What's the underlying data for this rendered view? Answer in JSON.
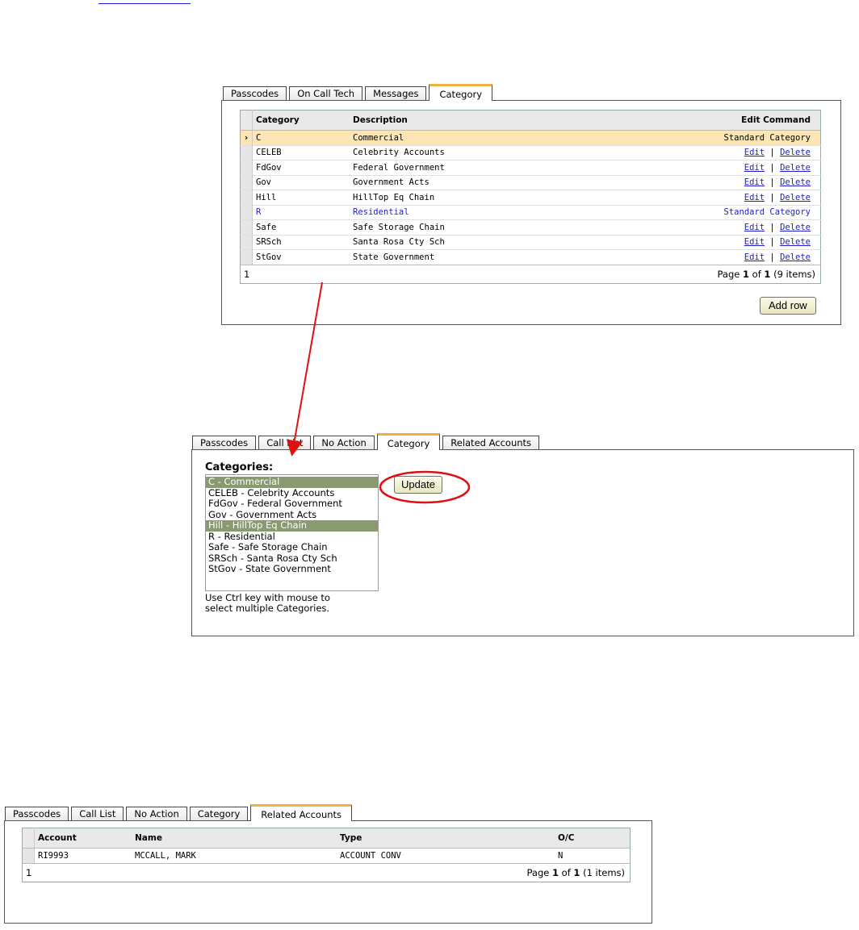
{
  "top_panel": {
    "tabs": [
      "Passcodes",
      "On Call Tech",
      "Messages",
      "Category"
    ],
    "active_tab": 3,
    "columns": {
      "category": "Category",
      "description": "Description",
      "edit_command": "Edit Command"
    },
    "rows": [
      {
        "category": "C",
        "description": "Commercial",
        "command": "Standard Category",
        "standard": true,
        "active": true
      },
      {
        "category": "CELEB",
        "description": "Celebrity Accounts",
        "standard": false
      },
      {
        "category": "FdGov",
        "description": "Federal Government",
        "standard": false
      },
      {
        "category": "Gov",
        "description": "Government Acts",
        "standard": false
      },
      {
        "category": "Hill",
        "description": "HillTop Eq Chain",
        "standard": false
      },
      {
        "category": "R",
        "description": "Residential",
        "command": "Standard Category",
        "standard": true,
        "blue": true
      },
      {
        "category": "Safe",
        "description": "Safe Storage Chain",
        "standard": false
      },
      {
        "category": "SRSch",
        "description": "Santa Rosa Cty Sch",
        "standard": false
      },
      {
        "category": "StGov",
        "description": "State Government",
        "standard": false
      }
    ],
    "edit_label": "Edit",
    "separator": "|",
    "delete_label": "Delete",
    "pager": {
      "page_number": "1",
      "page_word": "Page",
      "current": "1",
      "of_word": "of",
      "total": "1",
      "items": "(9 items)"
    },
    "add_row_label": "Add row"
  },
  "middle_panel": {
    "tabs": [
      "Passcodes",
      "Call List",
      "No Action",
      "Category",
      "Related Accounts"
    ],
    "active_tab": 3,
    "categories_label": "Categories:",
    "options": [
      {
        "label": "C - Commercial",
        "selected": true
      },
      {
        "label": "CELEB - Celebrity Accounts",
        "selected": false
      },
      {
        "label": "FdGov - Federal Government",
        "selected": false
      },
      {
        "label": "Gov - Government Acts",
        "selected": false
      },
      {
        "label": "Hill - HillTop Eq Chain",
        "selected": true
      },
      {
        "label": "R - Residential",
        "selected": false
      },
      {
        "label": "Safe - Safe Storage Chain",
        "selected": false
      },
      {
        "label": "SRSch - Santa Rosa Cty Sch",
        "selected": false
      },
      {
        "label": "StGov - State Government",
        "selected": false
      }
    ],
    "update_label": "Update",
    "hint_line1": "Use Ctrl key with mouse to",
    "hint_line2": "select multiple Categories."
  },
  "bottom_panel": {
    "tabs": [
      "Passcodes",
      "Call List",
      "No Action",
      "Category",
      "Related Accounts"
    ],
    "active_tab": 4,
    "columns": {
      "account": "Account",
      "name": "Name",
      "type": "Type",
      "oc": "O/C"
    },
    "rows": [
      {
        "account": "RI9993",
        "name": "MCCALL, MARK",
        "type": "ACCOUNT CONV",
        "oc": "N"
      }
    ],
    "pager": {
      "page_number": "1",
      "page_word": "Page",
      "current": "1",
      "of_word": "of",
      "total": "1",
      "items": "(1 items)"
    }
  },
  "colors": {
    "active_row": "#fde6b4",
    "tab_accent": "#f0b040",
    "selected_option": "#8a9a70",
    "link": "#1e1ec8",
    "annotation": "#e01010"
  }
}
